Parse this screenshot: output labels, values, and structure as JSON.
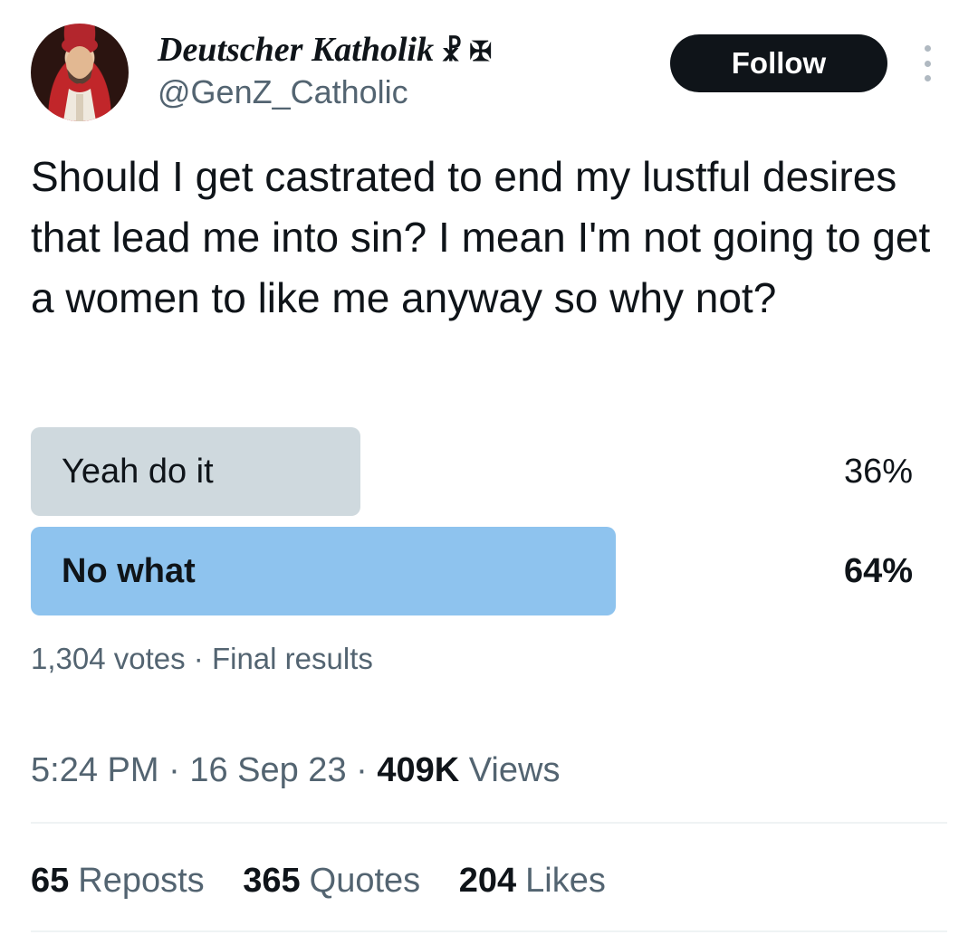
{
  "author": {
    "display_name": "Deutscher Katholik",
    "name_symbols": "☧ ✠",
    "handle": "@GenZ_Catholic",
    "avatar_icon": "portrait-avatar"
  },
  "header": {
    "follow_label": "Follow",
    "more_icon": "more-vertical-icon"
  },
  "tweet": {
    "text": "Should I get castrated to end my lustful desires that lead me into sin? I mean I'm not going to get a women to like me anyway so why not?"
  },
  "poll": {
    "options": [
      {
        "label": "Yeah do it",
        "percent_text": "36%",
        "percent": 36,
        "winner": false,
        "color": "#cfd9de"
      },
      {
        "label": "No what",
        "percent_text": "64%",
        "percent": 64,
        "winner": true,
        "color": "#8ec3ee"
      }
    ],
    "votes": "1,304 votes",
    "separator": "·",
    "status": "Final results"
  },
  "meta": {
    "time": "5:24 PM",
    "date": "16 Sep 23",
    "views_count": "409K",
    "views_label": "Views",
    "separator": "·"
  },
  "stats": [
    {
      "count": "65",
      "label": "Reposts"
    },
    {
      "count": "365",
      "label": "Quotes"
    },
    {
      "count": "204",
      "label": "Likes"
    }
  ],
  "colors": {
    "text_primary": "#0f1419",
    "text_secondary": "#536471",
    "follow_bg": "#0f1419"
  }
}
